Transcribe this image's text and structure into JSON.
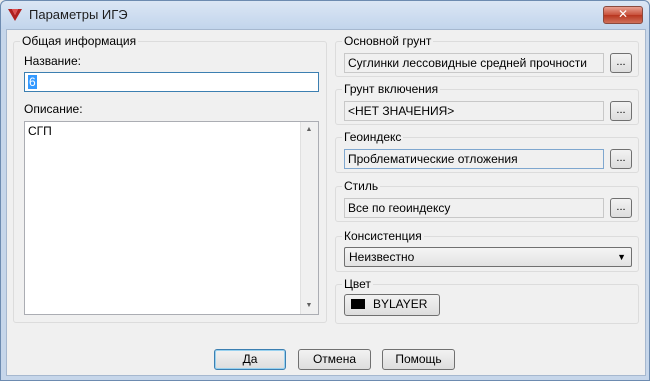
{
  "window": {
    "title": "Параметры ИГЭ",
    "close_glyph": "✕"
  },
  "general": {
    "caption": "Общая информация",
    "name_label": "Название:",
    "name_value": "6",
    "description_label": "Описание:",
    "description_value": "СГП"
  },
  "main_soil": {
    "caption": "Основной грунт",
    "value": "Суглинки лессовидные средней прочности",
    "button": "..."
  },
  "inclusion_soil": {
    "caption": "Грунт включения",
    "value": "<НЕТ ЗНАЧЕНИЯ>",
    "button": "..."
  },
  "geoindex": {
    "caption": "Геоиндекс",
    "value": "Проблематические отложения",
    "button": "..."
  },
  "style": {
    "caption": "Стиль",
    "value": "Все по геоиндексу",
    "button": "..."
  },
  "consistency": {
    "caption": "Консистенция",
    "selected": "Неизвестно"
  },
  "color": {
    "caption": "Цвет",
    "value": "BYLAYER",
    "swatch": "#000000"
  },
  "buttons": {
    "ok": "Да",
    "cancel": "Отмена",
    "help": "Помощь"
  },
  "colors": {
    "accent": "#3399ff",
    "title_bar": "#c2d5ec",
    "close": "#c8503a"
  }
}
